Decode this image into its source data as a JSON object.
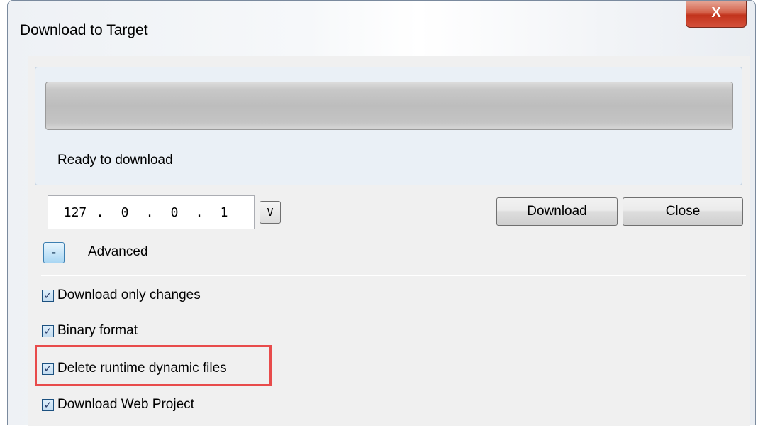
{
  "window": {
    "title": "Download to Target",
    "close_icon": "x-icon",
    "close_glyph": "X"
  },
  "status": {
    "progress": 0,
    "text": "Ready to download"
  },
  "address": {
    "segments": [
      "127",
      "0",
      "0",
      "1"
    ],
    "dot": ".",
    "dropdown_label": "V"
  },
  "buttons": {
    "download": "Download",
    "close": "Close"
  },
  "advanced": {
    "toggle": "-",
    "label": "Advanced"
  },
  "options": [
    {
      "label": "Download only changes",
      "checked": true
    },
    {
      "label": "Binary format",
      "checked": true
    },
    {
      "label": "Delete runtime dynamic files",
      "checked": true
    },
    {
      "label": "Download Web Project",
      "checked": true
    }
  ],
  "colors": {
    "highlight": "#e84b4b",
    "close_button": "#c2331c"
  }
}
